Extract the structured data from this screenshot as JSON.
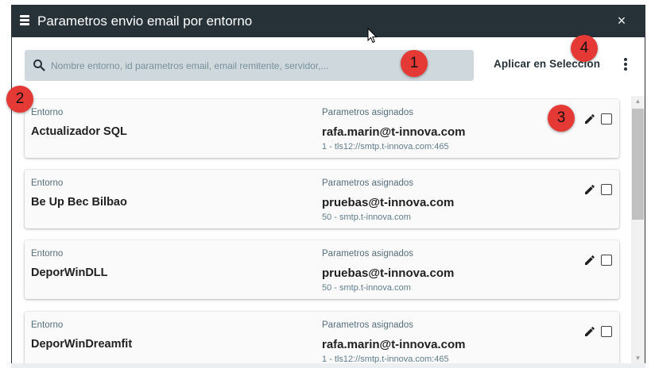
{
  "dialog": {
    "title": "Parametros envio email por entorno",
    "close_label": "×"
  },
  "toolbar": {
    "search_placeholder": "Nombre entorno, id parametros email, email remitente, servidor,...",
    "apply_label": "Aplicar en Seleccion"
  },
  "cards": [
    {
      "env_label": "Entorno",
      "env_name": "Actualizador SQL",
      "params_label": "Parametros asignados",
      "email": "rafa.marin@t-innova.com",
      "server": "1 - tls12://smtp.t-innova.com:465",
      "selected": false
    },
    {
      "env_label": "Entorno",
      "env_name": "Be Up Bec Bilbao",
      "params_label": "Parametros asignados",
      "email": "pruebas@t-innova.com",
      "server": "50 - smtp.t-innova.com",
      "selected": false
    },
    {
      "env_label": "Entorno",
      "env_name": "DeporWinDLL",
      "params_label": "Parametros asignados",
      "email": "pruebas@t-innova.com",
      "server": "50 - smtp.t-innova.com",
      "selected": false
    },
    {
      "env_label": "Entorno",
      "env_name": "DeporWinDreamfit",
      "params_label": "Parametros asignados",
      "email": "rafa.marin@t-innova.com",
      "server": "1 - tls12://smtp.t-innova.com:465",
      "selected": false
    }
  ],
  "badges": [
    "1",
    "2",
    "3",
    "4"
  ],
  "icons": {
    "menu": "list-icon",
    "search": "search-icon",
    "kebab": "more-vertical-icon",
    "edit": "pencil-icon",
    "checkbox": "checkbox-icon"
  },
  "colors": {
    "titlebar": "#263238",
    "search_bg": "#cfd8dc",
    "badge": "#e53935"
  }
}
